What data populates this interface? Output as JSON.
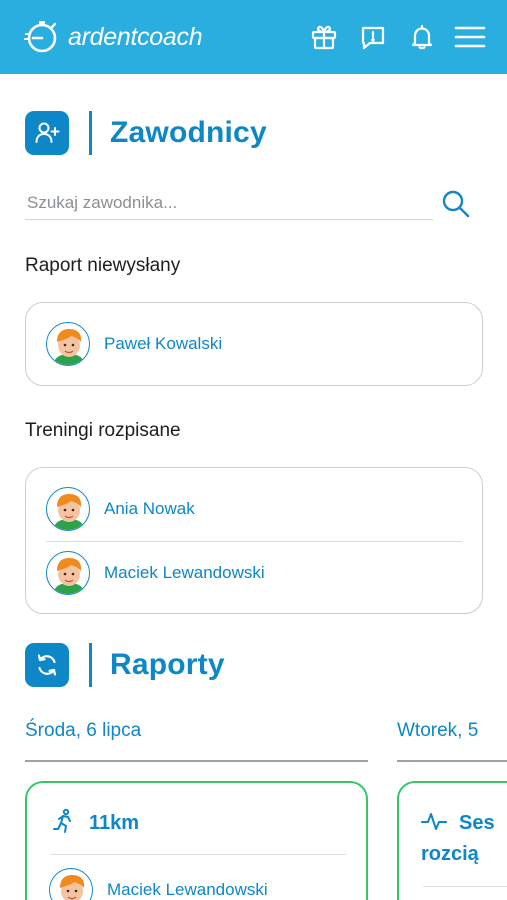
{
  "app": {
    "logo_text": "ardentcoach"
  },
  "topbar": {
    "icons": [
      "gift-icon",
      "feedback-icon",
      "bell-icon",
      "menu-icon"
    ]
  },
  "athletes": {
    "title": "Zawodnicy",
    "icon": "add-user-icon",
    "search_placeholder": "Szukaj zawodnika...",
    "groups": [
      {
        "label": "Raport niewysłany",
        "athletes": [
          "Paweł Kowalski"
        ]
      },
      {
        "label": "Treningi rozpisane",
        "athletes": [
          "Ania Nowak",
          "Maciek Lewandowski"
        ]
      }
    ]
  },
  "reports": {
    "title": "Raporty",
    "icon": "refresh-icon",
    "days": [
      {
        "date": "Środa, 6 lipca",
        "items": [
          {
            "icon": "running-icon",
            "value": "11km",
            "athlete": "Maciek Lewandowski"
          }
        ]
      },
      {
        "date": "Wtorek, 5",
        "items": [
          {
            "icon": "activity-pulse-icon",
            "value": "Ses",
            "value_line2": "rozcią"
          }
        ]
      }
    ]
  },
  "colors": {
    "topbar": "#2aaee0",
    "primary": "#0d87c7",
    "report_border": "#37c56a",
    "card_border": "#c9cfd3"
  }
}
